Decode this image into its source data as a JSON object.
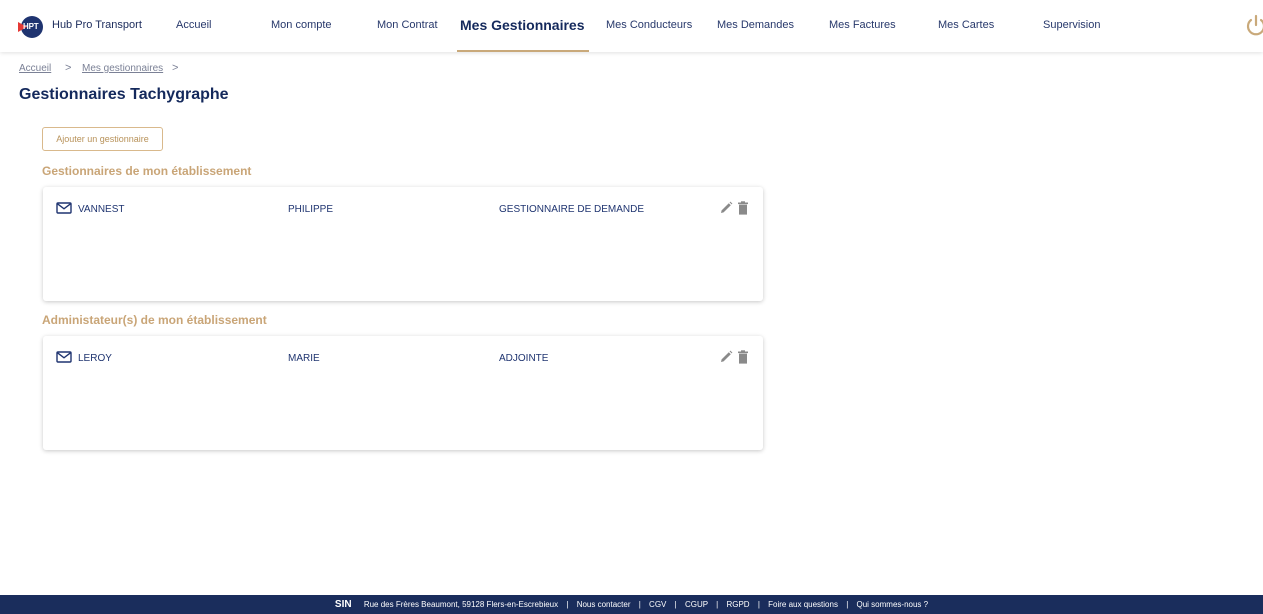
{
  "header": {
    "logo_text": "HPT",
    "brand": "Hub Pro Transport",
    "nav": [
      {
        "label": "Accueil"
      },
      {
        "label": "Mon compte"
      },
      {
        "label": "Mon Contrat"
      },
      {
        "label": "Mes Gestionnaires"
      },
      {
        "label": "Mes Conducteurs"
      },
      {
        "label": "Mes Demandes"
      },
      {
        "label": "Mes Factures"
      },
      {
        "label": "Mes Cartes"
      },
      {
        "label": "Supervision"
      }
    ],
    "active_nav": "Mes Gestionnaires"
  },
  "breadcrumb": {
    "items": [
      "Accueil",
      "Mes gestionnaires"
    ],
    "separator": ">"
  },
  "page": {
    "title": "Gestionnaires Tachygraphe",
    "add_button": "Ajouter un gestionnaire"
  },
  "sections": [
    {
      "title": "Gestionnaires de mon établissement",
      "rows": [
        {
          "last_name": "VANNEST",
          "first_name": "PHILIPPE",
          "role": "GESTIONNAIRE DE DEMANDE"
        }
      ]
    },
    {
      "title": "Administateur(s) de mon établissement",
      "rows": [
        {
          "last_name": "LEROY",
          "first_name": "MARIE",
          "role": "ADJOINTE"
        }
      ]
    }
  ],
  "footer": {
    "logo": "SIN",
    "address": "Rue des Frères Beaumont, 59128 Flers-en-Escrebieux",
    "links": [
      "Nous contacter",
      "CGV",
      "CGUP",
      "RGPD",
      "Foire aux questions",
      "Qui sommes-nous ?"
    ],
    "separator": "|"
  },
  "colors": {
    "navy": "#1a2d5c",
    "accent_gold": "#c9a97a",
    "section_title": "#c9a577",
    "logo_red": "#e53935"
  },
  "icons": [
    "hpt-logo",
    "power-icon",
    "mail-icon",
    "edit-icon",
    "trash-icon"
  ]
}
